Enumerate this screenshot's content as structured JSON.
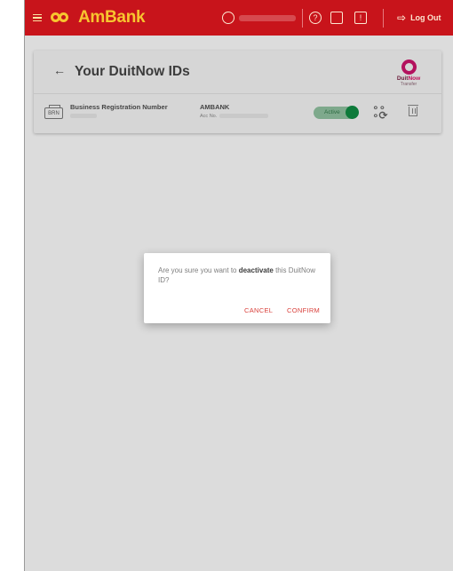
{
  "header": {
    "brand": "AmBank",
    "logout_label": "Log Out",
    "icons": [
      "menu-icon",
      "ambank-logo-icon",
      "user-icon",
      "help-icon",
      "card-icon",
      "message-icon",
      "logout-icon"
    ],
    "colors": {
      "background": "#c8141b",
      "brand_text": "#f7c52f"
    }
  },
  "page": {
    "title": "Your DuitNow IDs",
    "duitnow_logo": {
      "word_a": "Duit",
      "word_b": "Now",
      "sub": "Transfer"
    }
  },
  "id_row": {
    "badge": "BRN",
    "type": "Business Registration Number",
    "bank": "AMBANK",
    "acc_prefix": "Acc No.",
    "status": "Active"
  },
  "dialog": {
    "message_before": "Are you sure you want to ",
    "message_bold": "deactivate",
    "message_after": " this DuitNow ID?",
    "cancel_label": "CANCEL",
    "confirm_label": "CONFIRM",
    "accent_color": "#d9403b"
  }
}
